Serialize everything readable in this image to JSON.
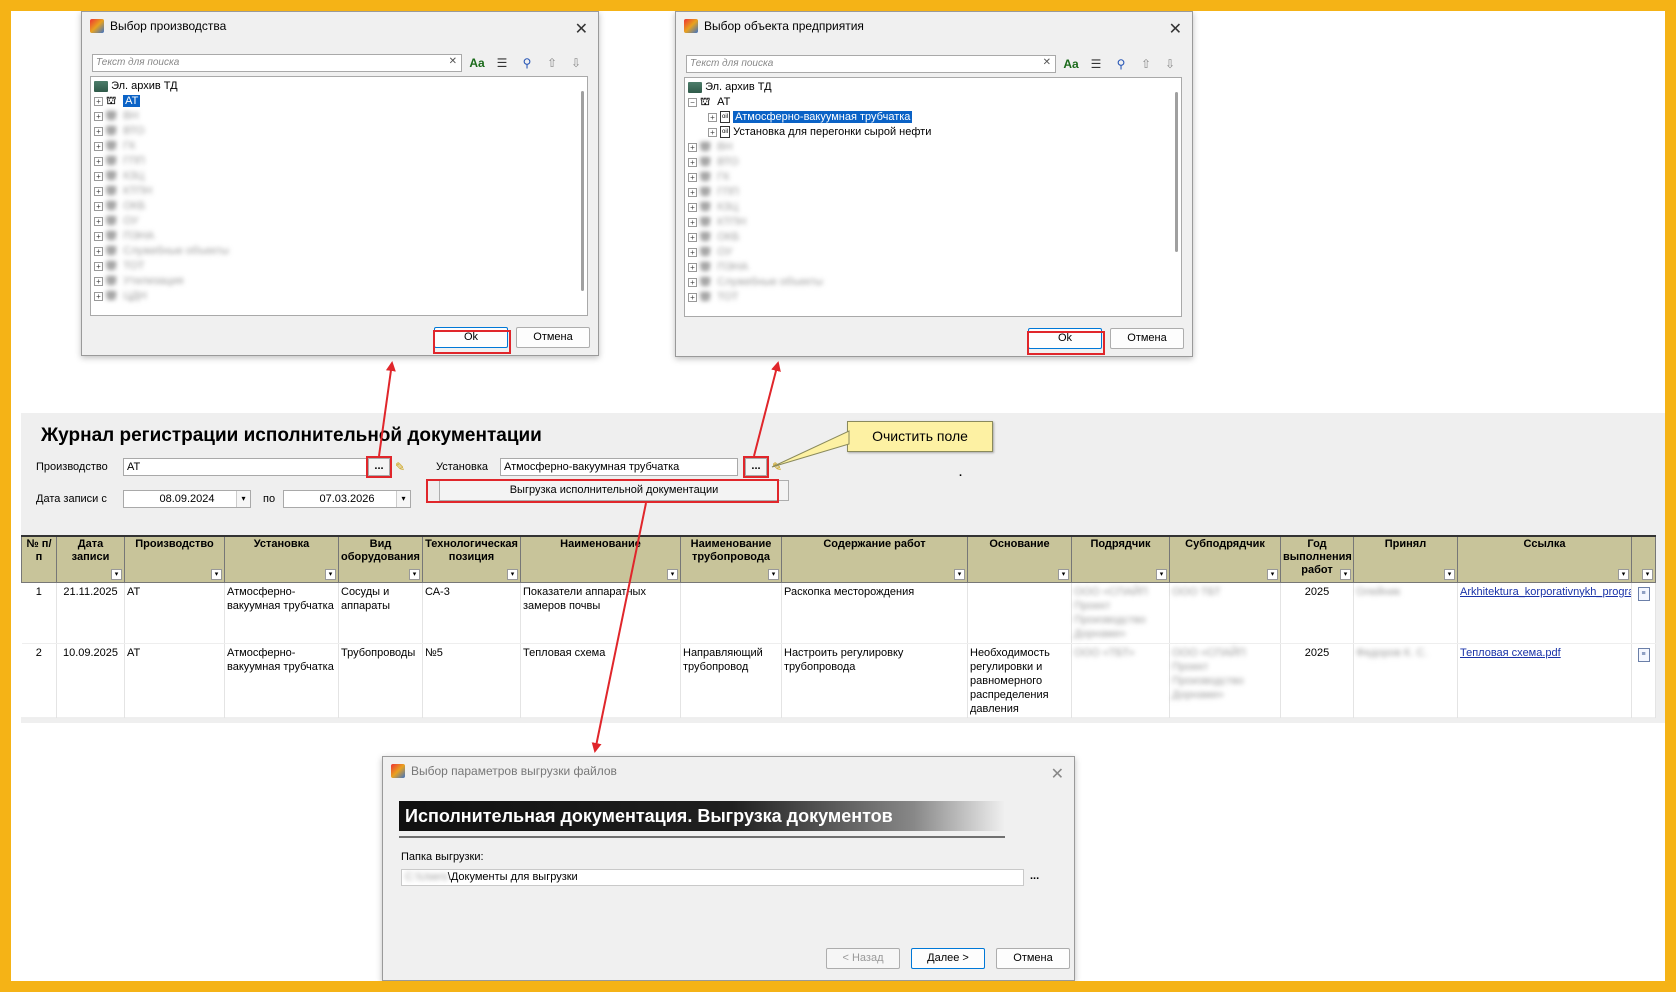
{
  "journal": {
    "title": "Журнал регистрации исполнительной документации",
    "production_label": "Производство",
    "production_value": "АТ",
    "installation_label": "Установка",
    "installation_value": "Атмосферно-вакуумная трубчатка",
    "date_from_label": "Дата записи с",
    "date_from": "08.09.2024",
    "date_to_label": "по",
    "date_to": "07.03.2026",
    "export_button": "Выгрузка исполнительной документации",
    "dots": "...",
    "stray_dot": "."
  },
  "callout": {
    "text": "Очистить поле"
  },
  "table": {
    "headers": [
      "№ п/п",
      "Дата записи",
      "Производство",
      "Установка",
      "Вид оборудования",
      "Технологическая позиция",
      "Наименование",
      "Наименование трубопровода",
      "Содержание работ",
      "Основание",
      "Подрядчик",
      "Субподрядчик",
      "Год выполнения работ",
      "Принял",
      "Ссылка"
    ],
    "rows": [
      {
        "num": "1",
        "date": "21.11.2025",
        "production": "АТ",
        "installation": "Атмосферно-вакуумная трубчатка",
        "equipment": "Сосуды и аппараты",
        "position": "СА-3",
        "name": "Показатели аппаратных замеров почвы",
        "pipeline": "",
        "work": "Раскопка месторождения",
        "basis": "",
        "contractor": "ООО «СПАЙП Проект Производство Дорнами»",
        "subcontractor": "ООО ТБТ",
        "year": "2025",
        "accepted": "Олейник",
        "link": "Arkhitektura_korporativnykh_progra"
      },
      {
        "num": "2",
        "date": "10.09.2025",
        "production": "АТ",
        "installation": "Атмосферно-вакуумная трубчатка",
        "equipment": "Трубопроводы",
        "position": "№5",
        "name": "Тепловая схема",
        "pipeline": "Направляющий трубопровод",
        "work": "Настроить регулировку трубопровода",
        "basis": "Необходимость регулировки и равномерного распределения давления",
        "contractor": "ООО «ТБТ»",
        "subcontractor": "ООО «СПАЙП Проект Производство Дорнами»",
        "year": "2025",
        "accepted": "Федоров К. С.",
        "link": "Тепловая схема.pdf"
      }
    ]
  },
  "dialog_production": {
    "title": "Выбор производства",
    "search_placeholder": "Текст для поиска",
    "root": "Эл. архив ТД",
    "selected": "АТ",
    "blurred_items": [
      "ВН",
      "ВТО",
      "ГК",
      "ГПП",
      "КЗЦ",
      "КТПН",
      "ОКБ",
      "ОУ",
      "ПЭНА",
      "Служебные объекты",
      "ТОТ",
      "Утилизация",
      "ЦДН"
    ],
    "ok": "Ok",
    "cancel": "Отмена"
  },
  "dialog_object": {
    "title": "Выбор объекта предприятия",
    "search_placeholder": "Текст для поиска",
    "root": "Эл. архив ТД",
    "parent": "АТ",
    "child_selected": "Атмосферно-вакуумная трубчатка",
    "child2": "Установка для перегонки сырой нефти",
    "blurred_items": [
      "ВН",
      "ВТО",
      "ГК",
      "ГПП",
      "КЗЦ",
      "КТПН",
      "ОКБ",
      "ОУ",
      "ПЭНА",
      "Служебные объекты",
      "ТОТ"
    ],
    "ok": "Ok",
    "cancel": "Отмена"
  },
  "dialog_export": {
    "title": "Выбор параметров выгрузки файлов",
    "banner": "Исполнительная документация. Выгрузка документов",
    "folder_label": "Папка выгрузки:",
    "folder_value": "\\Документы для выгрузки",
    "folder_prefix_blurred": "C:\\Users",
    "back": "< Назад",
    "next": "Далее >",
    "cancel": "Отмена",
    "dots": "..."
  },
  "colors": {
    "frame": "#F5B316",
    "highlight": "#E0262B",
    "header": "#C8C49A",
    "selection": "#0A62C6",
    "callout": "#FDF1A3",
    "link": "#1A33A8"
  }
}
